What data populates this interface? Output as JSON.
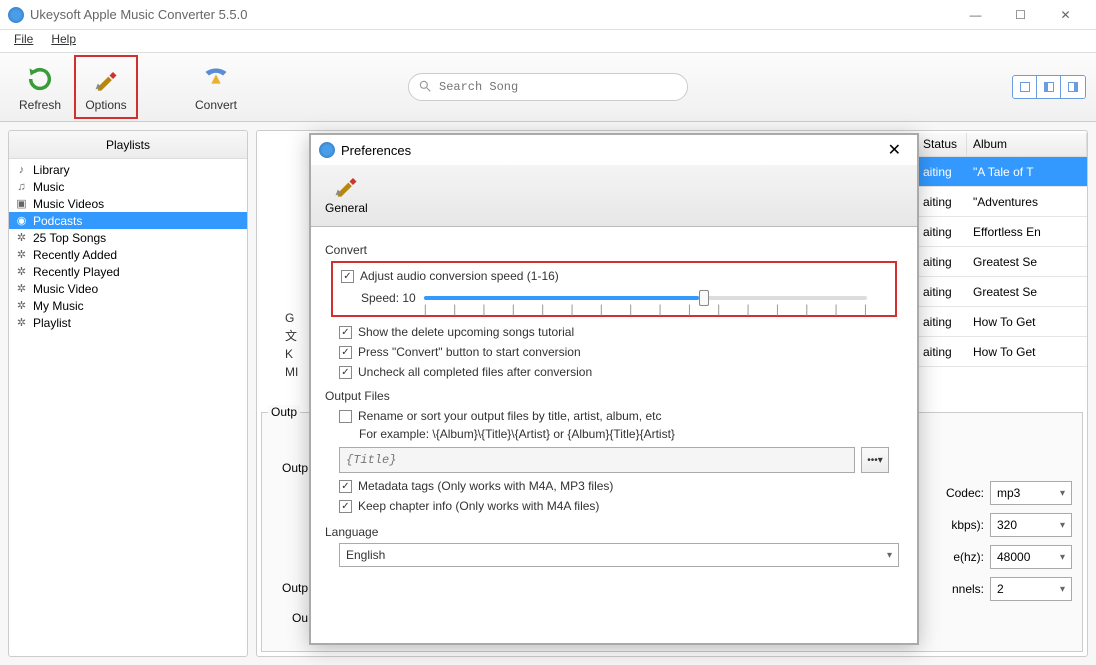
{
  "window": {
    "title": "Ukeysoft Apple Music Converter 5.5.0"
  },
  "menubar": {
    "file": "File",
    "help": "Help"
  },
  "toolbar": {
    "refresh": "Refresh",
    "options": "Options",
    "convert": "Convert"
  },
  "search": {
    "placeholder": "Search Song"
  },
  "sidebar": {
    "header": "Playlists",
    "items": [
      {
        "label": "Library",
        "icon": "library"
      },
      {
        "label": "Music",
        "icon": "music"
      },
      {
        "label": "Music Videos",
        "icon": "video"
      },
      {
        "label": "Podcasts",
        "icon": "podcast",
        "selected": true
      },
      {
        "label": "25 Top Songs",
        "icon": "gear"
      },
      {
        "label": "Recently Added",
        "icon": "gear"
      },
      {
        "label": "Recently Played",
        "icon": "gear"
      },
      {
        "label": "Music Video",
        "icon": "gear"
      },
      {
        "label": "My Music",
        "icon": "gear"
      },
      {
        "label": "Playlist",
        "icon": "gear"
      }
    ]
  },
  "behind_letters": {
    "l1": "G",
    "l2": "文",
    "l3": "K",
    "l4": "MI"
  },
  "table": {
    "status_header": "Status",
    "album_header": "Album",
    "rows": [
      {
        "status": "aiting",
        "album": "\"A Tale of T"
      },
      {
        "status": "aiting",
        "album": "\"Adventures"
      },
      {
        "status": "aiting",
        "album": "Effortless En"
      },
      {
        "status": "aiting",
        "album": "Greatest Se"
      },
      {
        "status": "aiting",
        "album": "Greatest Se"
      },
      {
        "status": "aiting",
        "album": "How To Get"
      },
      {
        "status": "aiting",
        "album": "How To Get"
      }
    ]
  },
  "output_panel": {
    "title_fragment": "Outp",
    "label1": "Outp",
    "label2": "Outp",
    "label3": "Ou",
    "codec_label": "Codec:",
    "codec_value": "mp3",
    "bitrate_label": "kbps):",
    "bitrate_value": "320",
    "samplerate_label": "e(hz):",
    "samplerate_value": "48000",
    "channels_label": "nnels:",
    "channels_value": "2"
  },
  "preferences": {
    "title": "Preferences",
    "tab_general": "General",
    "section_convert": "Convert",
    "adjust_speed_label": "Adjust audio conversion speed (1-16)",
    "speed_label": "Speed: 10",
    "speed_value": 10,
    "speed_min": 1,
    "speed_max": 16,
    "show_tutorial": "Show the delete upcoming songs tutorial",
    "press_convert": "Press \"Convert\" button to start conversion",
    "uncheck_completed": "Uncheck all completed files after conversion",
    "section_output": "Output Files",
    "rename_label": "Rename or sort your output files by title, artist, album, etc",
    "rename_example": "For example: \\{Album}\\{Title}\\{Artist} or {Album}{Title}{Artist}",
    "rename_placeholder": "{Title}",
    "metadata_tags": "Metadata tags (Only works with M4A, MP3 files)",
    "keep_chapter": "Keep chapter info (Only works with M4A files)",
    "section_language": "Language",
    "language_value": "English"
  }
}
